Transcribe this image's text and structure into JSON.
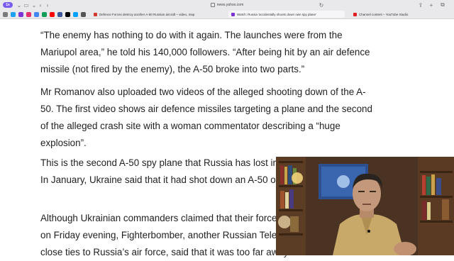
{
  "browser": {
    "badge_label": "1s",
    "url": "news.yahoo.com",
    "tabs": [
      {
        "label": "Defence Forces destroy another A-50 Russian aircraft – video, map",
        "color": "#d23b2f"
      },
      {
        "label": "Watch: Russia 'accidentally shoots down own spy plane'",
        "color": "#7b34d6"
      },
      {
        "label": "Channel content – YouTube Studio",
        "color": "#e02020"
      }
    ]
  },
  "article": {
    "p1": "“The enemy has nothing to do with it again. The launches were from the Mariupol area,” he told his 140,000 followers. “After being hit by an air defence missile (not fired by the enemy), the A-50 broke into two parts.”",
    "p2": "Mr Romanov also uploaded two videos of the alleged shooting down of the A-50. The first video shows air defence missiles targeting a plane and the second of the alleged crash site with a woman commentator describing a “huge explosion”.",
    "p3": "This is the second A-50 spy plane that Russia has lost in the space of a month. In January, Ukraine said that it had shot down an A-50 over the Sea of Azov.",
    "p4": "Although Ukrainian commanders claimed that their forces shot down the A-50 on Friday evening, Fighterbomber, another Russian Telegram channel with close ties to Russia’s air force, said that it was too far away"
  }
}
